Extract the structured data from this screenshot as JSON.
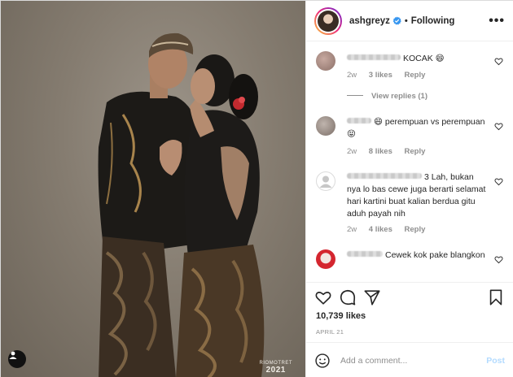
{
  "post": {
    "username": "ashgreyz",
    "follow_status": "Following",
    "more_icon": "ellipsis-icon",
    "verified_color": "#3897f0",
    "likes_text": "10,739 likes",
    "date": "APRIL 21"
  },
  "photo": {
    "watermark_brand": "RIOMOTRET",
    "watermark_year": "2021"
  },
  "comments": [
    {
      "text": "KOCAK 😄",
      "age": "2w",
      "likes": "3 likes",
      "reply": "Reply",
      "view_replies": "View replies (1)"
    },
    {
      "text": "😄 perempuan vs perempuan😝",
      "age": "2w",
      "likes": "8 likes",
      "reply": "Reply"
    },
    {
      "text": "3 Lah, bukan nya lo bas cewe juga berarti selamat hari kartini buat kalian berdua gitu aduh payah nih",
      "age": "2w",
      "likes": "4 likes",
      "reply": "Reply"
    },
    {
      "text": "Cewek kok pake blangkon"
    }
  ],
  "composer": {
    "placeholder": "Add a comment...",
    "post_label": "Post"
  }
}
